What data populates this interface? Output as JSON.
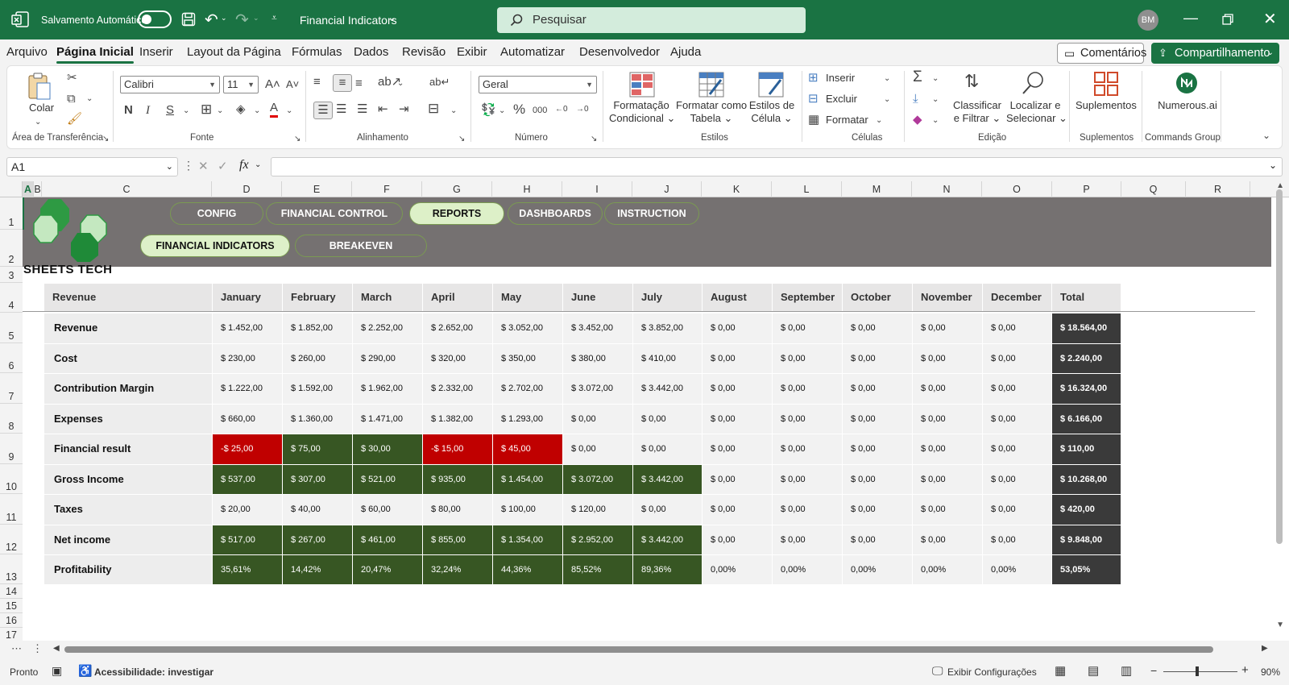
{
  "titlebar": {
    "autosave_label": "Salvamento Automático",
    "doc_title": "Financial Indicators",
    "search_placeholder": "Pesquisar",
    "avatar_initials": "BM"
  },
  "menu": {
    "tabs": [
      "Arquivo",
      "Página Inicial",
      "Inserir",
      "Layout da Página",
      "Fórmulas",
      "Dados",
      "Revisão",
      "Exibir",
      "Automatizar",
      "Desenvolvedor",
      "Ajuda"
    ],
    "active_index": 1,
    "comments_label": "Comentários",
    "share_label": "Compartilhamento"
  },
  "ribbon": {
    "paste_label": "Colar",
    "clipboard_group": "Área de Transferência",
    "font_name": "Calibri",
    "font_size": "11",
    "font_group": "Fonte",
    "align_group": "Alinhamento",
    "number_format": "Geral",
    "number_group": "Número",
    "cond_format_l1": "Formatação",
    "cond_format_l2": "Condicional",
    "format_table_l1": "Formatar como",
    "format_table_l2": "Tabela",
    "cell_styles_l1": "Estilos de",
    "cell_styles_l2": "Célula",
    "styles_group": "Estilos",
    "insert_label": "Inserir",
    "delete_label": "Excluir",
    "format_label": "Formatar",
    "cells_group": "Células",
    "sort_l1": "Classificar",
    "sort_l2": "e Filtrar",
    "find_l1": "Localizar e",
    "find_l2": "Selecionar",
    "editing_group": "Edição",
    "addins_label": "Suplementos",
    "addins_group": "Suplementos",
    "numerous_label": "Numerous.ai",
    "commands_group": "Commands Group"
  },
  "formula": {
    "name_box": "A1",
    "fx": "fx",
    "content": ""
  },
  "columns": [
    "A",
    "B",
    "C",
    "D",
    "E",
    "F",
    "G",
    "H",
    "I",
    "J",
    "K",
    "L",
    "M",
    "N",
    "O",
    "P",
    "Q",
    "R"
  ],
  "rows": [
    "1",
    "2",
    "3",
    "4",
    "5",
    "6",
    "7",
    "8",
    "9",
    "10",
    "11",
    "12",
    "13",
    "14",
    "15",
    "16",
    "17"
  ],
  "banner": {
    "nav_top": [
      "CONFIG",
      "FINANCIAL CONTROL",
      "REPORTS",
      "DASHBOARDS",
      "INSTRUCTION"
    ],
    "nav_bottom": [
      "FINANCIAL INDICATORS",
      "BREAKEVEN"
    ],
    "brand": "SHEETS TECH"
  },
  "table": {
    "headers": [
      "Revenue",
      "January",
      "February",
      "March",
      "April",
      "May",
      "June",
      "July",
      "August",
      "September",
      "October",
      "November",
      "December",
      "Total"
    ],
    "rows": [
      {
        "label": "Revenue",
        "values": [
          "$ 1.452,00",
          "$ 1.852,00",
          "$ 2.252,00",
          "$ 2.652,00",
          "$ 3.052,00",
          "$ 3.452,00",
          "$ 3.852,00",
          "$ 0,00",
          "$ 0,00",
          "$ 0,00",
          "$ 0,00",
          "$ 0,00"
        ],
        "total": "$ 18.564,00"
      },
      {
        "label": "Cost",
        "values": [
          "$ 230,00",
          "$ 260,00",
          "$ 290,00",
          "$ 320,00",
          "$ 350,00",
          "$ 380,00",
          "$ 410,00",
          "$ 0,00",
          "$ 0,00",
          "$ 0,00",
          "$ 0,00",
          "$ 0,00"
        ],
        "total": "$ 2.240,00"
      },
      {
        "label": "Contribution Margin",
        "values": [
          "$ 1.222,00",
          "$ 1.592,00",
          "$ 1.962,00",
          "$ 2.332,00",
          "$ 2.702,00",
          "$ 3.072,00",
          "$ 3.442,00",
          "$ 0,00",
          "$ 0,00",
          "$ 0,00",
          "$ 0,00",
          "$ 0,00"
        ],
        "total": "$ 16.324,00"
      },
      {
        "label": "Expenses",
        "values": [
          "$ 660,00",
          "$ 1.360,00",
          "$ 1.471,00",
          "$ 1.382,00",
          "$ 1.293,00",
          "$ 0,00",
          "$ 0,00",
          "$ 0,00",
          "$ 0,00",
          "$ 0,00",
          "$ 0,00",
          "$ 0,00"
        ],
        "total": "$ 6.166,00"
      },
      {
        "label": "Financial result",
        "values": [
          "-$ 25,00",
          "$ 75,00",
          "$ 30,00",
          "-$ 15,00",
          "$ 45,00",
          "$ 0,00",
          "$ 0,00",
          "$ 0,00",
          "$ 0,00",
          "$ 0,00",
          "$ 0,00",
          "$ 0,00"
        ],
        "total": "$ 110,00",
        "fills": [
          "r",
          "g",
          "g",
          "r",
          "r",
          "",
          "",
          "",
          "",
          "",
          "",
          ""
        ]
      },
      {
        "label": "Gross Income",
        "values": [
          "$ 537,00",
          "$ 307,00",
          "$ 521,00",
          "$ 935,00",
          "$ 1.454,00",
          "$ 3.072,00",
          "$ 3.442,00",
          "$ 0,00",
          "$ 0,00",
          "$ 0,00",
          "$ 0,00",
          "$ 0,00"
        ],
        "total": "$ 10.268,00",
        "fills": [
          "g",
          "g",
          "g",
          "g",
          "g",
          "g",
          "g",
          "",
          "",
          "",
          "",
          ""
        ]
      },
      {
        "label": "Taxes",
        "values": [
          "$ 20,00",
          "$ 40,00",
          "$ 60,00",
          "$ 80,00",
          "$ 100,00",
          "$ 120,00",
          "$ 0,00",
          "$ 0,00",
          "$ 0,00",
          "$ 0,00",
          "$ 0,00",
          "$ 0,00"
        ],
        "total": "$ 420,00"
      },
      {
        "label": "Net income",
        "values": [
          "$ 517,00",
          "$ 267,00",
          "$ 461,00",
          "$ 855,00",
          "$ 1.354,00",
          "$ 2.952,00",
          "$ 3.442,00",
          "$ 0,00",
          "$ 0,00",
          "$ 0,00",
          "$ 0,00",
          "$ 0,00"
        ],
        "total": "$ 9.848,00",
        "fills": [
          "g",
          "g",
          "g",
          "g",
          "g",
          "g",
          "g",
          "",
          "",
          "",
          "",
          ""
        ]
      },
      {
        "label": "Profitability",
        "values": [
          "35,61%",
          "14,42%",
          "20,47%",
          "32,24%",
          "44,36%",
          "85,52%",
          "89,36%",
          "0,00%",
          "0,00%",
          "0,00%",
          "0,00%",
          "0,00%"
        ],
        "total": "53,05%",
        "fills": [
          "g",
          "g",
          "g",
          "g",
          "g",
          "g",
          "g",
          "",
          "",
          "",
          "",
          ""
        ]
      }
    ]
  },
  "colors": {
    "green_fill": "#375623",
    "red_fill": "#c00000",
    "total_fill": "#3a3a3a",
    "banner": "#757171",
    "excel_green": "#1a7343"
  },
  "status": {
    "ready": "Pronto",
    "accessibility": "Acessibilidade: investigar",
    "display_settings": "Exibir Configurações",
    "zoom": "90%"
  }
}
